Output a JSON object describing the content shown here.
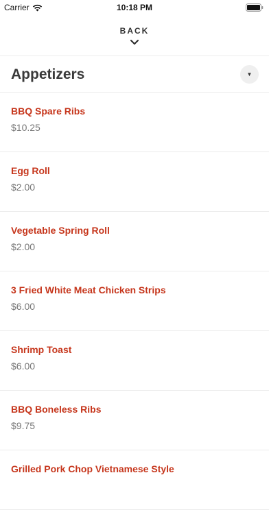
{
  "status_bar": {
    "carrier": "Carrier",
    "time": "10:18 PM"
  },
  "header": {
    "back_label": "BACK"
  },
  "category": {
    "title": "Appetizers",
    "toggle_glyph": "▼"
  },
  "items": [
    {
      "name": "BBQ Spare Ribs",
      "price": "$10.25"
    },
    {
      "name": "Egg Roll",
      "price": "$2.00"
    },
    {
      "name": "Vegetable Spring Roll",
      "price": "$2.00"
    },
    {
      "name": "3 Fried White Meat Chicken Strips",
      "price": "$6.00"
    },
    {
      "name": "Shrimp Toast",
      "price": "$6.00"
    },
    {
      "name": "BBQ Boneless Ribs",
      "price": "$9.75"
    },
    {
      "name": "Grilled Pork Chop Vietnamese Style",
      "price": ""
    }
  ],
  "colors": {
    "item_name": "#c6361c",
    "price": "#777777",
    "divider": "#ececec"
  }
}
